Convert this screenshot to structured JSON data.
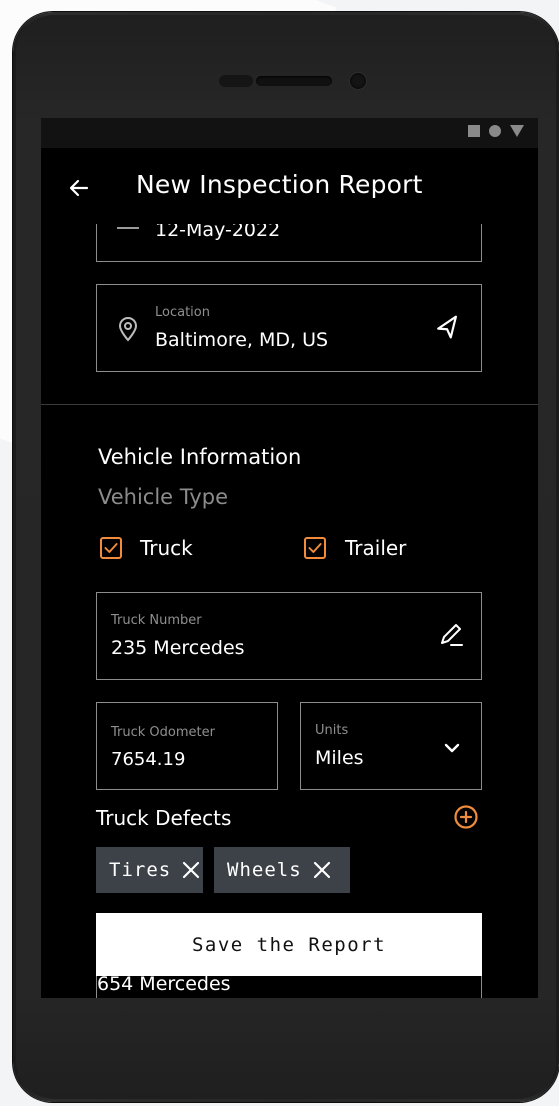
{
  "app": {
    "title": "New Inspection Report"
  },
  "date_field": {
    "value": "12-May-2022"
  },
  "location_field": {
    "label": "Location",
    "value": "Baltimore, MD, US"
  },
  "vehicle": {
    "heading": "Vehicle Information",
    "type_label": "Vehicle Type",
    "types": [
      {
        "label": "Truck",
        "checked": true
      },
      {
        "label": "Trailer",
        "checked": true
      }
    ]
  },
  "truck_number": {
    "label": "Truck Number",
    "value": "235 Mercedes"
  },
  "odometer": {
    "label": "Truck Odometer",
    "value": "7654.19"
  },
  "units": {
    "label": "Units",
    "value": "Miles"
  },
  "defects": {
    "heading": "Truck Defects",
    "items": [
      "Tires",
      "Wheels"
    ]
  },
  "save_button": {
    "label": "Save the Report"
  },
  "next_field": {
    "value": "654 Mercedes"
  },
  "colors": {
    "accent": "#f08c3c",
    "chip_bg": "#3d4248",
    "screen_bg": "#000000"
  },
  "icons": [
    "back-arrow-icon",
    "calendar-icon",
    "location-pin-icon",
    "navigation-icon",
    "edit-pencil-icon",
    "chevron-down-icon",
    "plus-circle-icon",
    "close-icon"
  ]
}
